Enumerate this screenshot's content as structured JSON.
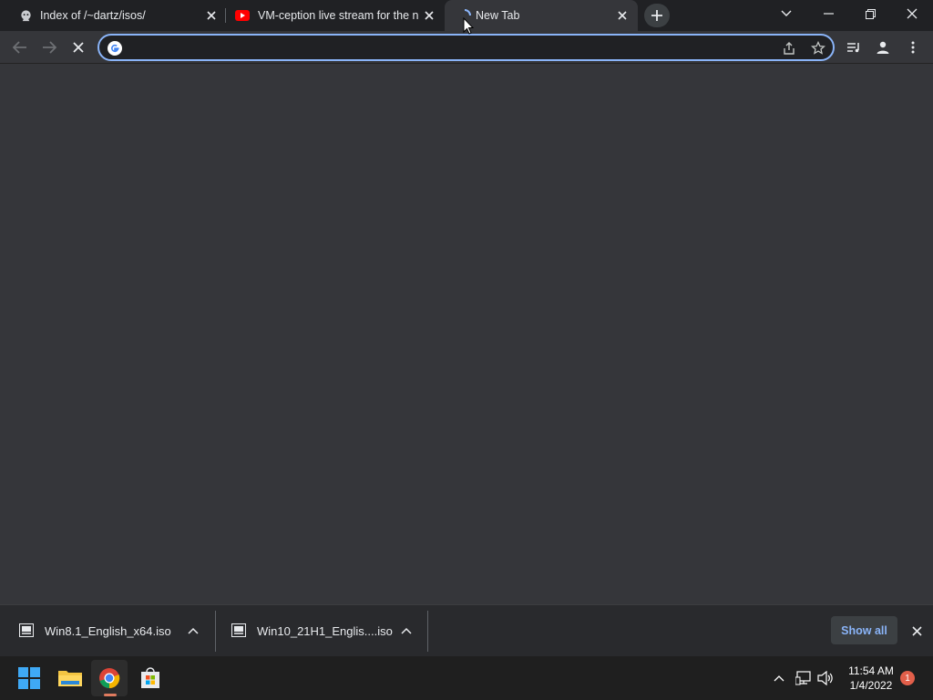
{
  "tabs": [
    {
      "title": "Index of /~dartz/isos/",
      "icon": "github-octocat-icon"
    },
    {
      "title": "VM-ception live stream for the n",
      "icon": "youtube-icon"
    },
    {
      "title": "New Tab",
      "icon": "loading-spinner-icon",
      "active": true
    }
  ],
  "omnibox": {
    "value": "",
    "placeholder": ""
  },
  "downloads": [
    {
      "name": "Win8.1_English_x64.iso"
    },
    {
      "name": "Win10_21H1_Englis....iso"
    }
  ],
  "shelf": {
    "show_all_label": "Show all"
  },
  "taskbar": {
    "apps": [
      "windows-start-icon",
      "file-explorer-icon",
      "chrome-icon",
      "store-icon"
    ],
    "time": "11:54 AM",
    "date": "1/4/2022",
    "notification_count": "1"
  },
  "colors": {
    "tabstrip_bg": "#202124",
    "toolbar_bg": "#35363a",
    "omnibox_focus": "#8ab4f8",
    "shelf_bg": "#292a2d",
    "taskbar_bg": "#1f1f1f",
    "accent_link": "#8ab4f8"
  }
}
